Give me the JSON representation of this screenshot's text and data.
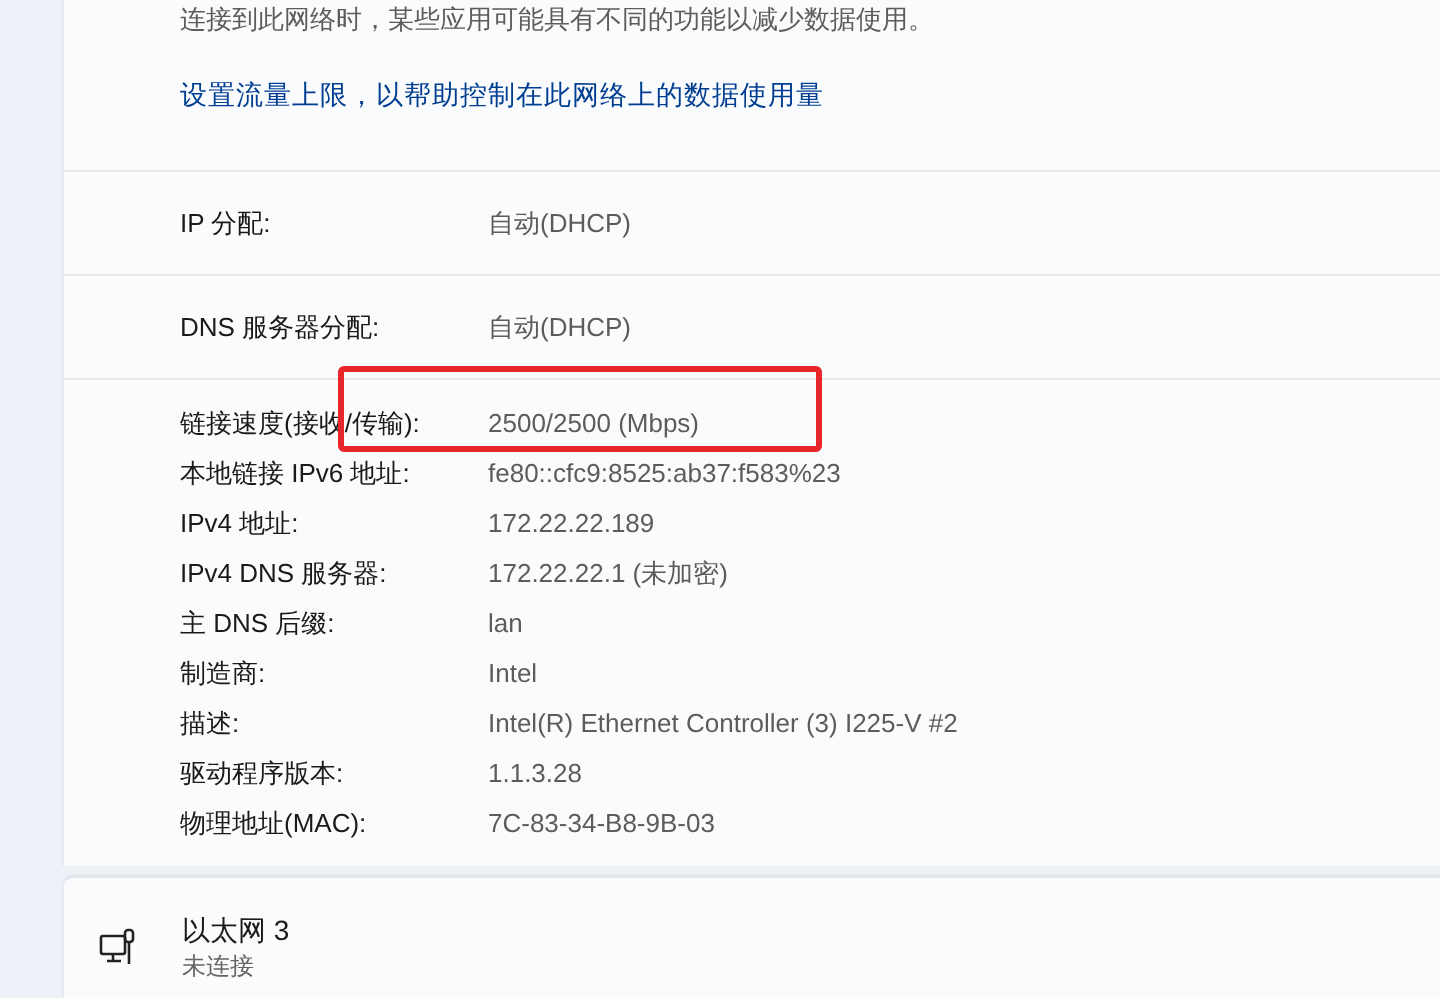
{
  "metered_note": "连接到此网络时，某些应用可能具有不同的功能以减少数据使用。",
  "data_limit_link": "设置流量上限，以帮助控制在此网络上的数据使用量",
  "settings": [
    {
      "label": "IP 分配:",
      "value": "自动(DHCP)"
    },
    {
      "label": "DNS 服务器分配:",
      "value": "自动(DHCP)"
    }
  ],
  "properties": [
    {
      "label": "链接速度(接收/传输):",
      "value": "2500/2500 (Mbps)",
      "highlighted": true
    },
    {
      "label": "本地链接 IPv6 地址:",
      "value": "fe80::cfc9:8525:ab37:f583%23",
      "highlighted": false
    },
    {
      "label": "IPv4 地址:",
      "value": "172.22.22.189",
      "highlighted": false
    },
    {
      "label": "IPv4 DNS 服务器:",
      "value": "172.22.22.1 (未加密)",
      "highlighted": false
    },
    {
      "label": "主 DNS 后缀:",
      "value": "lan",
      "highlighted": false
    },
    {
      "label": "制造商:",
      "value": "Intel",
      "highlighted": false
    },
    {
      "label": "描述:",
      "value": "Intel(R) Ethernet Controller (3) I225-V #2",
      "highlighted": false
    },
    {
      "label": "驱动程序版本:",
      "value": "1.1.3.28",
      "highlighted": false
    },
    {
      "label": "物理地址(MAC):",
      "value": "7C-83-34-B8-9B-03",
      "highlighted": false
    }
  ],
  "adapter": {
    "name": "以太网 3",
    "status": "未连接"
  }
}
